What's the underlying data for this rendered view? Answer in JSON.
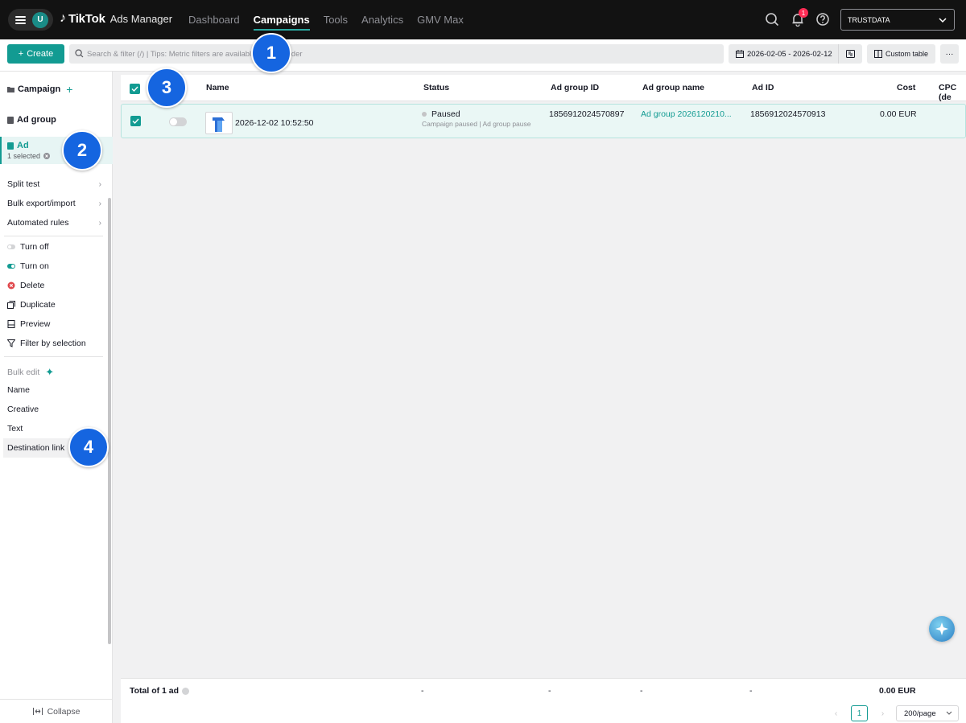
{
  "header": {
    "avatar_initial": "U",
    "brand_tiktok": "TikTok",
    "brand_product": "Ads Manager",
    "nav": [
      "Dashboard",
      "Campaigns",
      "Tools",
      "Analytics",
      "GMV Max"
    ],
    "active_nav": "Campaigns",
    "notification_count": "1",
    "account": "TRUSTDATA",
    "icons": [
      "menu-icon",
      "search-icon",
      "bell-icon",
      "help-icon",
      "chevron-down-icon"
    ]
  },
  "toolbar": {
    "create_label": "Create",
    "search_placeholder": "Search & filter (/) | Tips: Metric filters are available in the header",
    "date_range": "2026-02-05 - 2026-02-12",
    "custom_table_label": "Custom table",
    "more_label": "···"
  },
  "sidebar": {
    "campaign_label": "Campaign",
    "adgroup_label": "Ad group",
    "ad_label": "Ad",
    "ad_selected": "1 selected",
    "menu": [
      "Split test",
      "Bulk export/import",
      "Automated rules"
    ],
    "actions": [
      "Turn off",
      "Turn on",
      "Delete",
      "Duplicate",
      "Preview",
      "Filter by selection"
    ],
    "bulk_edit_label": "Bulk edit",
    "bulk_items": [
      "Name",
      "Creative",
      "Text",
      "Destination link"
    ],
    "collapse_label": "Collapse"
  },
  "table": {
    "columns": [
      "Name",
      "Status",
      "Ad group ID",
      "Ad group name",
      "Ad ID",
      "Cost",
      "CPC (de"
    ],
    "row": {
      "name": "2026-12-02 10:52:50",
      "status": "Paused",
      "status_detail": "Campaign paused | Ad group pause",
      "ad_group_id": "1856912024570897",
      "ad_group_name": "Ad group 2026120210...",
      "ad_id": "1856912024570913",
      "cost": "0.00 EUR"
    },
    "footer": {
      "total_label": "Total of 1 ad",
      "status": "-",
      "ad_group_id": "-",
      "ad_group_name": "-",
      "ad_id": "-",
      "cost": "0.00 EUR"
    }
  },
  "pagination": {
    "current_page": "1",
    "per_page": "200/page"
  },
  "callouts": [
    "1",
    "2",
    "3",
    "4"
  ],
  "colors": {
    "accent": "#129b92",
    "callout": "#1565e0",
    "topbar": "#121212",
    "badge": "#fe2c55"
  }
}
